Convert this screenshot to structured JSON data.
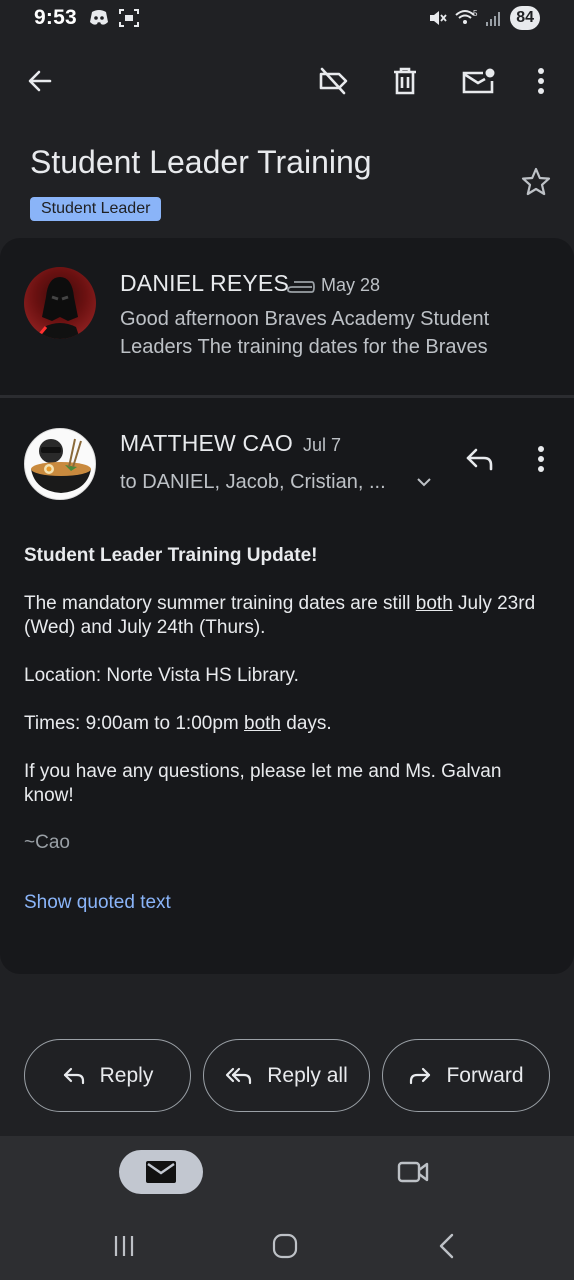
{
  "status_bar": {
    "time": "9:53",
    "battery": "84",
    "wifi_label": "5"
  },
  "toolbar": {
    "back_icon": "arrow-left-icon",
    "label_off_icon": "label-off-icon",
    "delete_icon": "trash-icon",
    "mark_unread_icon": "mail-unread-icon",
    "more_icon": "more-vert-icon"
  },
  "thread": {
    "subject": "Student Leader Training",
    "label": "Student Leader",
    "label_color": "#8ab4f8"
  },
  "messages": [
    {
      "sender": "DANIEL REYES",
      "date": "May 28",
      "has_attachment": true,
      "snippet": "Good afternoon Braves Academy Student Leaders The training dates for the Braves"
    },
    {
      "sender": "MATTHEW CAO",
      "date": "Jul 7",
      "recipients": "to DANIEL, Jacob, Cristian, ...",
      "body": {
        "heading": "Student Leader Training Update!",
        "p1_before": "The mandatory summer training dates are still ",
        "p1_underlined": "both",
        "p1_after": " July 23rd (Wed) and July 24th (Thurs).",
        "p2": "Location: Norte Vista HS Library.",
        "p3_before": "Times: 9:00am to 1:00pm ",
        "p3_underlined": "both",
        "p3_after": " days.",
        "p4": "If you have any questions, please let me and Ms. Galvan know!",
        "signature": "~Cao"
      },
      "show_quoted": "Show quoted text"
    }
  ],
  "actions": {
    "reply": "Reply",
    "reply_all": "Reply all",
    "forward": "Forward"
  },
  "bottom_nav": {
    "mail_icon": "mail-icon",
    "meet_icon": "video-camera-icon"
  },
  "colors": {
    "background": "#202124",
    "card": "#17181b",
    "accent": "#8ab4f8"
  }
}
